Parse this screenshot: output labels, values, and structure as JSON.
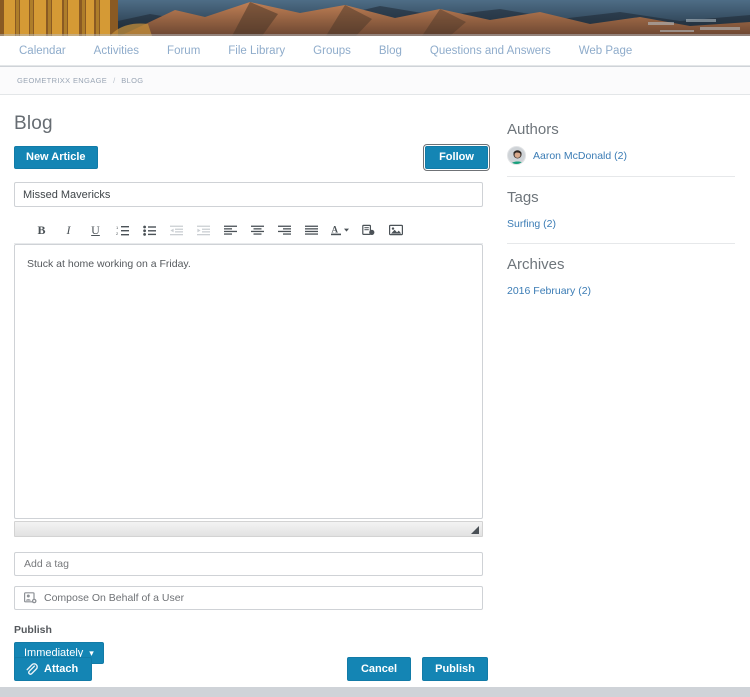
{
  "nav": {
    "items": [
      {
        "label": "Calendar"
      },
      {
        "label": "Activities"
      },
      {
        "label": "Forum"
      },
      {
        "label": "File Library"
      },
      {
        "label": "Groups"
      },
      {
        "label": "Blog"
      },
      {
        "label": "Questions and Answers"
      },
      {
        "label": "Web Page"
      }
    ]
  },
  "breadcrumb": {
    "root": "GEOMETRIXX ENGAGE",
    "separator": "/",
    "current": "BLOG"
  },
  "page": {
    "title": "Blog",
    "new_article_label": "New Article",
    "follow_label": "Follow"
  },
  "editor": {
    "title_value": "Missed Mavericks",
    "title_placeholder": "",
    "body_text": "Stuck at home working on a Friday.",
    "toolbar": [
      {
        "name": "bold-icon",
        "label": "B",
        "disabled": false
      },
      {
        "name": "italic-icon",
        "label": "I",
        "disabled": false
      },
      {
        "name": "underline-icon",
        "label": "U",
        "disabled": false
      },
      {
        "name": "numbered-list-icon",
        "label": "",
        "disabled": false
      },
      {
        "name": "bulleted-list-icon",
        "label": "",
        "disabled": false
      },
      {
        "name": "outdent-icon",
        "label": "",
        "disabled": true
      },
      {
        "name": "indent-icon",
        "label": "",
        "disabled": true
      },
      {
        "name": "align-left-icon",
        "label": "",
        "disabled": false
      },
      {
        "name": "align-center-icon",
        "label": "",
        "disabled": false
      },
      {
        "name": "align-right-icon",
        "label": "",
        "disabled": false
      },
      {
        "name": "justify-icon",
        "label": "",
        "disabled": false
      },
      {
        "name": "text-color-icon",
        "label": "A",
        "disabled": false
      },
      {
        "name": "link-icon",
        "label": "",
        "disabled": false
      },
      {
        "name": "image-icon",
        "label": "",
        "disabled": false
      }
    ]
  },
  "form": {
    "tag_placeholder": "Add a tag",
    "tag_value": "",
    "behalf_label": "Compose On Behalf of a User",
    "publish_label": "Publish",
    "publish_option": "Immediately",
    "publish_caret": "▾"
  },
  "actions": {
    "attach_label": "Attach",
    "cancel_label": "Cancel",
    "publish_label": "Publish"
  },
  "aside": {
    "authors": {
      "title": "Authors",
      "items": [
        {
          "label": "Aaron McDonald (2)"
        }
      ]
    },
    "tags": {
      "title": "Tags",
      "items": [
        {
          "label": "Surfing (2)"
        }
      ]
    },
    "archives": {
      "title": "Archives",
      "items": [
        {
          "label": "2016 February (2)"
        }
      ]
    }
  },
  "colors": {
    "accent": "#1485b4",
    "link": "#3b7cb5",
    "nav_link": "#8faccb",
    "title_text": "#666c72"
  }
}
